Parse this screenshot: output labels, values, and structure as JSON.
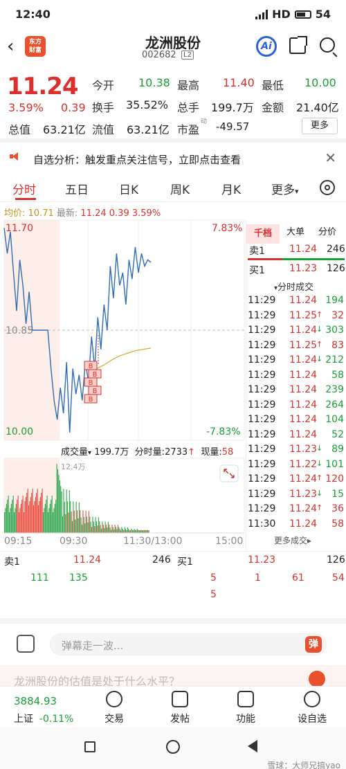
{
  "status": {
    "time": "12:40",
    "network": "HD",
    "battery": "54"
  },
  "header": {
    "name": "龙洲股份",
    "code": "002682",
    "l2": "L2",
    "logo_line1": "东方",
    "logo_line2": "财富",
    "ai": "Ai"
  },
  "quote": {
    "price": "11.24",
    "change_pct": "3.59%",
    "change_amt": "0.39",
    "open_label": "今开",
    "open": "10.38",
    "high_label": "最高",
    "high": "11.40",
    "low_label": "最低",
    "low": "10.00",
    "turnover_label": "换手",
    "turnover": "35.52%",
    "volume_label": "总手",
    "volume": "199.7万",
    "amount_label": "金额",
    "amount": "21.40亿",
    "mcap_label": "总值",
    "mcap": "63.21亿",
    "float_label": "流值",
    "float_mcap": "63.21亿",
    "pe_label": "市盈",
    "pe_sup": "动",
    "pe": "-49.57",
    "more": "更多"
  },
  "notice": {
    "text": "自选分析：触发重点关注信号，立即点击查看"
  },
  "tabs": [
    "分时",
    "五日",
    "日K",
    "周K",
    "月K",
    "更多"
  ],
  "avginfo": {
    "avg_label": "均价:",
    "avg": "10.71",
    "latest_label": "最新:",
    "latest": "11.24",
    "chg": "0.39",
    "pct": "3.59%"
  },
  "chart_data": {
    "type": "line",
    "y_top": "11.70",
    "y_mid": "10.85",
    "y_bottom": "10.00",
    "pct_top": "7.83%",
    "pct_bottom": "-7.83%",
    "ylim": [
      10.0,
      11.7
    ],
    "x_labels": [
      "09:15",
      "09:30",
      "11:30/13:00",
      "15:00"
    ],
    "price_series": [
      11.65,
      11.45,
      11.62,
      11.3,
      11.0,
      11.4,
      11.2,
      10.9,
      11.15,
      10.85,
      10.85,
      10.85,
      10.85,
      10.85,
      10.85,
      10.55,
      10.3,
      10.15,
      10.4,
      10.2,
      10.6,
      10.05,
      10.55,
      10.35,
      10.5,
      10.3,
      10.6,
      10.45,
      10.8,
      10.55,
      10.95,
      10.7,
      11.05,
      10.85,
      11.35,
      11.1,
      11.45,
      11.2,
      11.3,
      11.05,
      11.4,
      11.25,
      11.5,
      11.3,
      11.45,
      11.35,
      11.4,
      11.38
    ],
    "avg_series": [
      10.55,
      10.58,
      10.62,
      10.65,
      10.67,
      10.69,
      10.7,
      10.71
    ],
    "volume_max_label": "12.4万",
    "markers": [
      "B",
      "B",
      "B",
      "B",
      "B"
    ]
  },
  "volinfo": {
    "label": "成交量",
    "vol": "199.7万",
    "tick_label": "分时量:",
    "tick_vol": "2733",
    "now_label": "现量:",
    "now": "58"
  },
  "panel": {
    "tabs": [
      "千档",
      "大单",
      "分价"
    ],
    "sell1_label": "卖1",
    "sell1_price": "11.24",
    "sell1_vol": "246",
    "buy1_label": "买1",
    "buy1_price": "11.23",
    "buy1_vol": "126",
    "ticks_title": "分时成交",
    "ticks": [
      {
        "t": "11:29",
        "p": "11.24",
        "a": "",
        "v": "194",
        "c": "green"
      },
      {
        "t": "11:29",
        "p": "11.25",
        "a": "↑",
        "v": "32",
        "c": "red"
      },
      {
        "t": "11:29",
        "p": "11.24",
        "a": "↓",
        "v": "303",
        "c": "green"
      },
      {
        "t": "11:29",
        "p": "11.25",
        "a": "↑",
        "v": "83",
        "c": "red"
      },
      {
        "t": "11:29",
        "p": "11.24",
        "a": "↓",
        "v": "212",
        "c": "green"
      },
      {
        "t": "11:29",
        "p": "11.24",
        "a": "",
        "v": "58",
        "c": "green"
      },
      {
        "t": "11:29",
        "p": "11.24",
        "a": "",
        "v": "239",
        "c": "green"
      },
      {
        "t": "11:29",
        "p": "11.24",
        "a": "",
        "v": "264",
        "c": "green"
      },
      {
        "t": "11:29",
        "p": "11.24",
        "a": "",
        "v": "104",
        "c": "green"
      },
      {
        "t": "11:29",
        "p": "11.24",
        "a": "",
        "v": "52",
        "c": "green"
      },
      {
        "t": "11:29",
        "p": "11.23",
        "a": "↓",
        "v": "89",
        "c": "green"
      },
      {
        "t": "11:29",
        "p": "11.22",
        "a": "↓",
        "v": "101",
        "c": "green"
      },
      {
        "t": "11:29",
        "p": "11.24",
        "a": "↑",
        "v": "120",
        "c": "red"
      },
      {
        "t": "11:29",
        "p": "11.23",
        "a": "↓",
        "v": "15",
        "c": "green"
      },
      {
        "t": "11:29",
        "p": "11.24",
        "a": "↑",
        "v": "36",
        "c": "red"
      },
      {
        "t": "11:30",
        "p": "11.24",
        "a": "",
        "v": "58",
        "c": "red"
      }
    ],
    "more_ticks": "更多成交▸"
  },
  "bottom_book": {
    "sell_label": "卖1",
    "sell_price": "11.24",
    "sell_vol": "246",
    "buy_label": "买1",
    "buy_price": "11.23",
    "buy_vol": "126",
    "sell_row2": [
      "111",
      "135"
    ],
    "buy_row2": [
      "5",
      "1",
      "61",
      "54"
    ],
    "buy_row3": [
      "5"
    ]
  },
  "comment": {
    "placeholder": "弹幕走一波...",
    "danmu": "弹"
  },
  "promo": {
    "text": "龙洲股份的估值是处于什么水平？"
  },
  "bottomnav": {
    "index_value": "3884.93",
    "index_name": "上证",
    "index_chg": "-0.11%",
    "items": [
      "交易",
      "发帖",
      "功能",
      "设自选"
    ]
  },
  "watermark": "雪球：大师兄搞yao"
}
